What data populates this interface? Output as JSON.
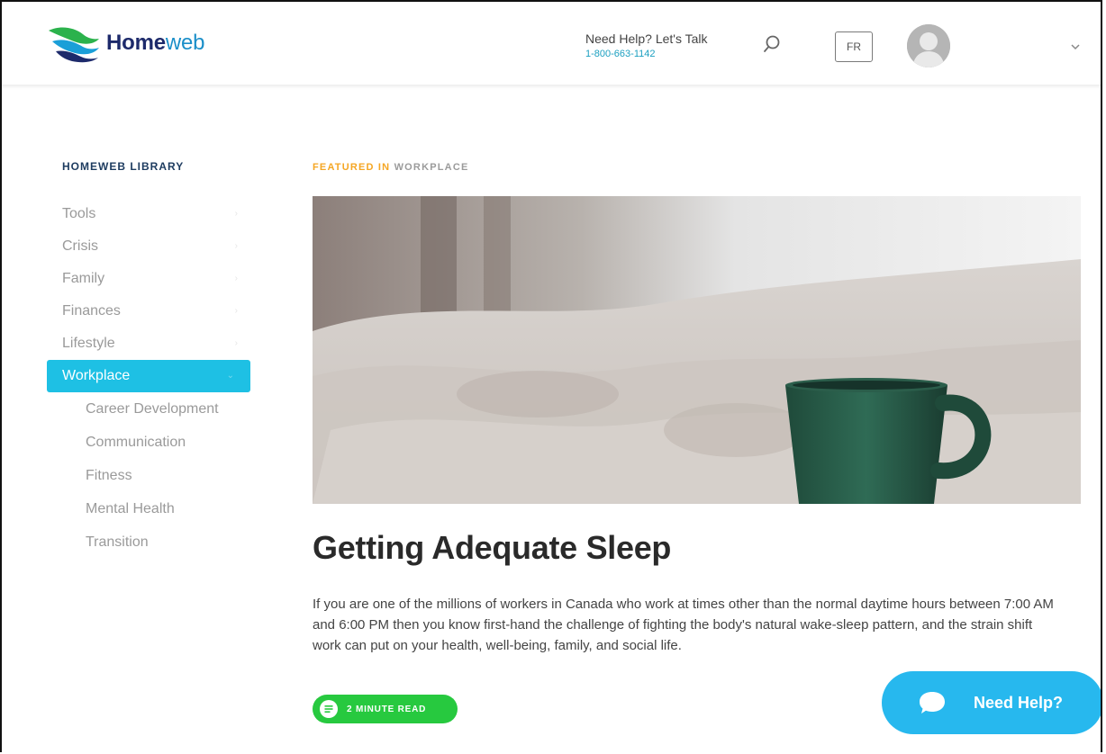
{
  "header": {
    "logo_bold": "Home",
    "logo_light": "web",
    "help_title": "Need Help? Let's Talk",
    "help_phone": "1-800-663-1142",
    "lang_label": "FR"
  },
  "sidebar": {
    "heading": "HOMEWEB LIBRARY",
    "items": [
      {
        "label": "Tools"
      },
      {
        "label": "Crisis"
      },
      {
        "label": "Family"
      },
      {
        "label": "Finances"
      },
      {
        "label": "Lifestyle"
      },
      {
        "label": "Workplace",
        "active": true
      }
    ],
    "subitems": [
      {
        "label": "Career Development"
      },
      {
        "label": "Communication"
      },
      {
        "label": "Fitness"
      },
      {
        "label": "Mental Health"
      },
      {
        "label": "Transition"
      }
    ]
  },
  "main": {
    "featured_in": "FEATURED IN",
    "featured_category": "WORKPLACE",
    "title": "Getting Adequate Sleep",
    "body": "If you are one of the millions of workers in Canada who work at times other than the normal daytime hours between 7:00 AM and 6:00 PM then you know first-hand the challenge of fighting the body's natural wake-sleep pattern, and the strain shift work can put on your health, well-being, family, and social life.",
    "read_time": "2 MINUTE READ"
  },
  "help_button": {
    "label": "Need Help?"
  },
  "colors": {
    "accent": "#1ec0e4",
    "brand_navy": "#1d2a6b",
    "featured_orange": "#f5a623",
    "badge_green": "#27c93f",
    "fab_blue": "#27b8ee"
  },
  "icons": {
    "search": "search-icon",
    "chevron": "chevron-down-icon",
    "chat": "chat-bubble-icon",
    "article": "article-icon"
  }
}
